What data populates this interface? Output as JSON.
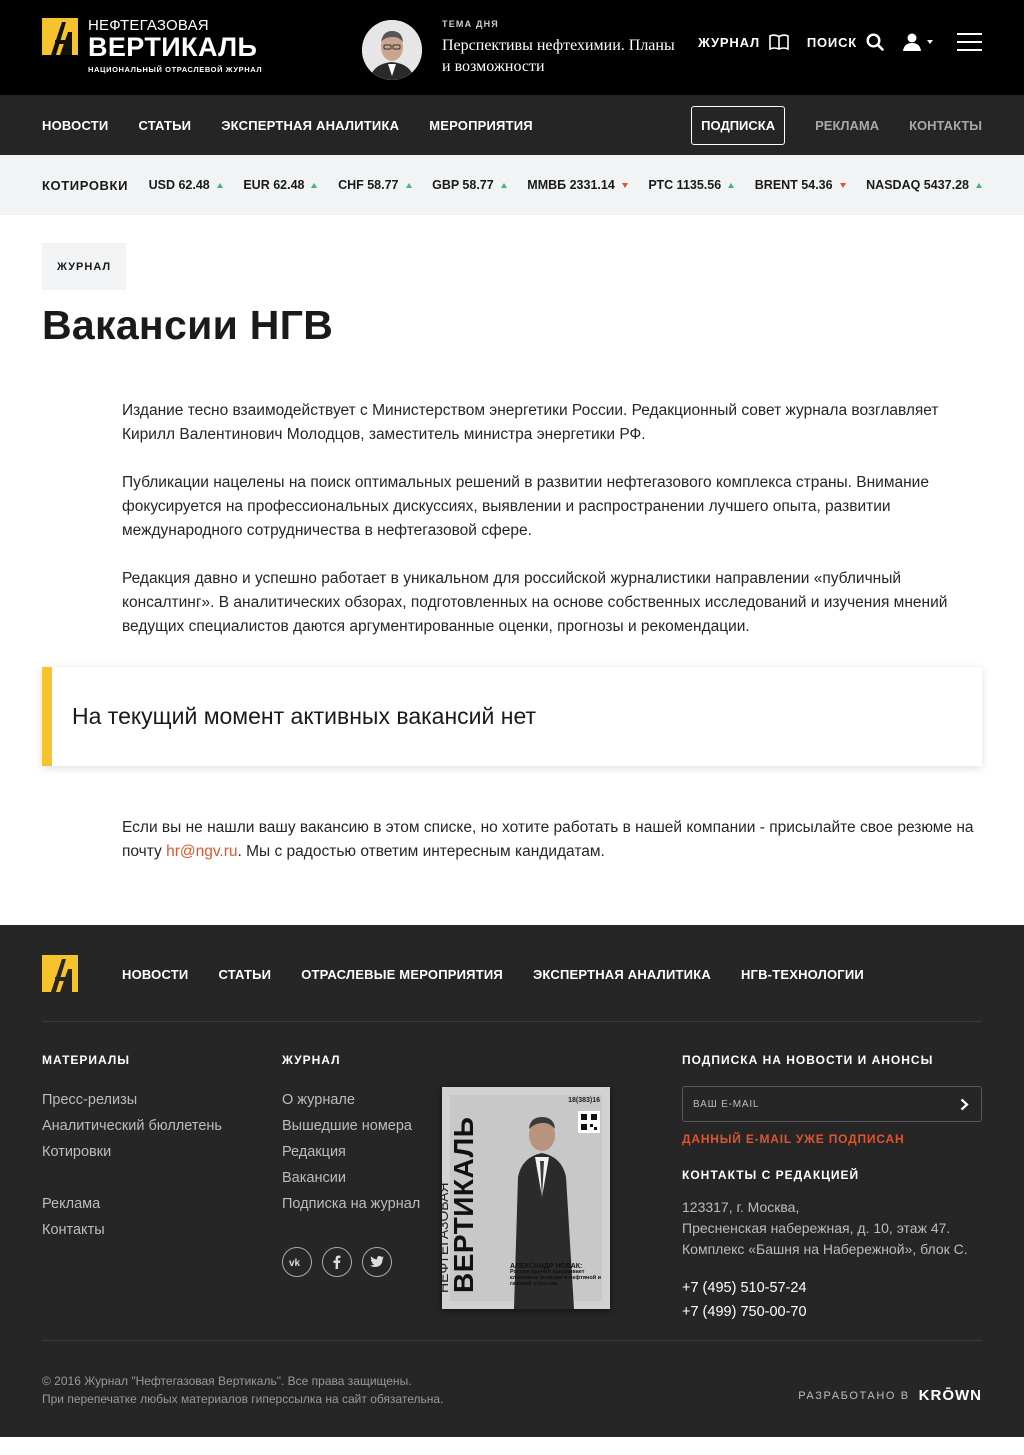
{
  "header": {
    "logo": {
      "line1": "НЕФТЕГАЗОВАЯ",
      "line2": "ВЕРТИКАЛЬ",
      "line3": "НАЦИОНАЛЬНЫЙ ОТРАСЛЕВОЙ ЖУРНАЛ"
    },
    "topic_label": "ТЕМА ДНЯ",
    "topic_title": "Перспективы нефтехимии. Планы и возможности",
    "journal_label": "ЖУРНАЛ",
    "search_label": "ПОИСК"
  },
  "nav": {
    "left": [
      "НОВОСТИ",
      "СТАТЬИ",
      "ЭКСПЕРТНАЯ АНАЛИТИКА",
      "МЕРОПРИЯТИЯ"
    ],
    "subscribe": "ПОДПИСКА",
    "right": [
      "РЕКЛАМА",
      "КОНТАКТЫ"
    ]
  },
  "quotes": {
    "label": "КОТИРОВКИ",
    "items": [
      {
        "text": "USD 62.48",
        "trend": "up"
      },
      {
        "text": "EUR 62.48",
        "trend": "up"
      },
      {
        "text": "CHF 58.77",
        "trend": "up"
      },
      {
        "text": "GBP 58.77",
        "trend": "up"
      },
      {
        "text": "ММВБ 2331.14",
        "trend": "down"
      },
      {
        "text": "РТС 1135.56",
        "trend": "up"
      },
      {
        "text": "BRENT 54.36",
        "trend": "down"
      },
      {
        "text": "NASDAQ 5437.28",
        "trend": "up"
      }
    ]
  },
  "main": {
    "crumb": "ЖУРНАЛ",
    "title": "Вакансии НГВ",
    "paragraphs": [
      "Издание тесно взаимодействует с Министерством энергетики России. Редакционный совет журнала возглавляет Кирилл Валентинович Молодцов, заместитель министра энергетики РФ.",
      "Публикации нацелены на поиск оптимальных решений в развитии нефтегазового комплекса страны. Внимание фокусируется на профессиональных дискуссиях, выявлении и распространении лучшего опыта, развитии международного сотрудничества в нефтегазовой сфере.",
      "Редакция давно и успешно работает в уникальном для российской журналистики направлении «публичный консалтинг». В аналитических обзорах, подготовленных на основе собственных исследований и изучения мнений ведущих специалистов даются аргументированные оценки, прогнозы и рекомендации."
    ],
    "notice": "На текущий момент активных вакансий нет",
    "after_prefix": "Если вы не нашли вашу вакансию в этом списке, но хотите работать в нашей компании - присылайте свое резюме на почту ",
    "after_email": "hr@ngv.ru",
    "after_suffix": ". Мы с радостью ответим интересным кандидатам."
  },
  "footer": {
    "nav": [
      "НОВОСТИ",
      "СТАТЬИ",
      "ОТРАСЛЕВЫЕ МЕРОПРИЯТИЯ",
      "ЭКСПЕРТНАЯ АНАЛИТИКА",
      "НГВ-ТЕХНОЛОГИИ"
    ],
    "materials_head": "МАТЕРИАЛЫ",
    "materials": [
      "Пресс-релизы",
      "Аналитический бюллетень",
      "Котировки"
    ],
    "materials2": [
      "Реклама",
      "Контакты"
    ],
    "journal_head": "ЖУРНАЛ",
    "journal": [
      "О журнале",
      "Вышедшие номера",
      "Редакция",
      "Вакансии",
      "Подписка на журнал"
    ],
    "subscribe_head": "ПОДПИСКА НА НОВОСТИ И АНОНСЫ",
    "email_placeholder": "ВАШ E-MAIL",
    "email_error": "ДАННЫЙ E-MAIL УЖЕ ПОДПИСАН",
    "contacts_head": "КОНТАКТЫ С РЕДАКЦИЕЙ",
    "address": [
      "123317, г. Москва,",
      "Пресненская набережная, д. 10, этаж 47.",
      "Комплекс «Башня на Набережной», блок С."
    ],
    "phones": [
      "+7 (495) 510-57-24",
      "+7 (499) 750-00-70"
    ],
    "copyright": [
      "© 2016 Журнал \"Нефтегазовая Вертикаль\". Все права защищены.",
      "При перепечатке любых материалов гиперссылка на сайт обязательна."
    ],
    "dev_label": "РАЗРАБОТАНО В",
    "dev_name": "KRŌWN",
    "cover": {
      "issue": "18(383)16",
      "line1": "НЕФТЕГАЗОВАЯ",
      "line2": "ВЕРТИКАЛЬ",
      "headline": "АЛЕКСАНДР НОВАК:",
      "subline": "Россия прочно удерживает ключевые позиции в нефтяной и газовой отраслях"
    }
  },
  "colors": {
    "accent": "#f6c32c",
    "link": "#e0542c",
    "up": "#4caf7d",
    "down": "#e0542c"
  }
}
